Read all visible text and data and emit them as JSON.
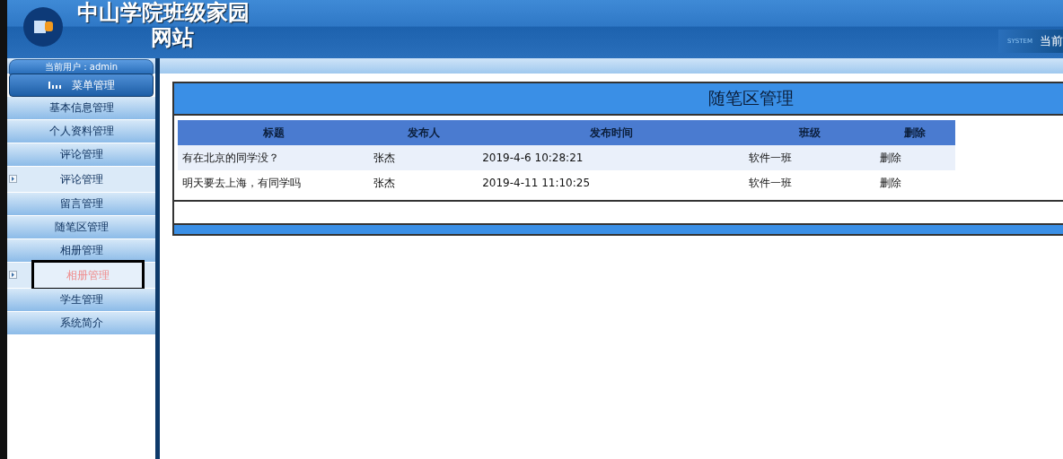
{
  "header": {
    "title_line1": "中山学院班级家园",
    "title_line2": "网站",
    "system_badge": "SYSTEM",
    "right_text": "当前"
  },
  "user_tab": {
    "text": "当前用户：admin"
  },
  "menu": {
    "title": "菜单管理",
    "items": [
      {
        "kind": "group",
        "label": "基本信息管理",
        "selected": false
      },
      {
        "kind": "group",
        "label": "个人资料管理",
        "selected": false
      },
      {
        "kind": "group",
        "label": "评论管理",
        "selected": false
      },
      {
        "kind": "sub",
        "label": "评论管理",
        "selected": false
      },
      {
        "kind": "group",
        "label": "留言管理",
        "selected": false
      },
      {
        "kind": "group",
        "label": "随笔区管理",
        "selected": false
      },
      {
        "kind": "group",
        "label": "相册管理",
        "selected": false
      },
      {
        "kind": "sub",
        "label": "相册管理",
        "selected": true
      },
      {
        "kind": "group",
        "label": "学生管理",
        "selected": false
      },
      {
        "kind": "group",
        "label": "系统简介",
        "selected": false
      }
    ]
  },
  "panel": {
    "title": "随笔区管理",
    "table": {
      "columns": [
        "标题",
        "发布人",
        "发布时间",
        "班级",
        "删除"
      ],
      "rows": [
        {
          "cells": [
            "有在北京的同学没？",
            "张杰",
            "2019-4-6 10:28:21",
            "软件一班",
            "删除"
          ]
        },
        {
          "cells": [
            "明天要去上海，有同学吗",
            "张杰",
            "2019-4-11 11:10:25",
            "软件一班",
            "删除"
          ]
        }
      ]
    }
  }
}
